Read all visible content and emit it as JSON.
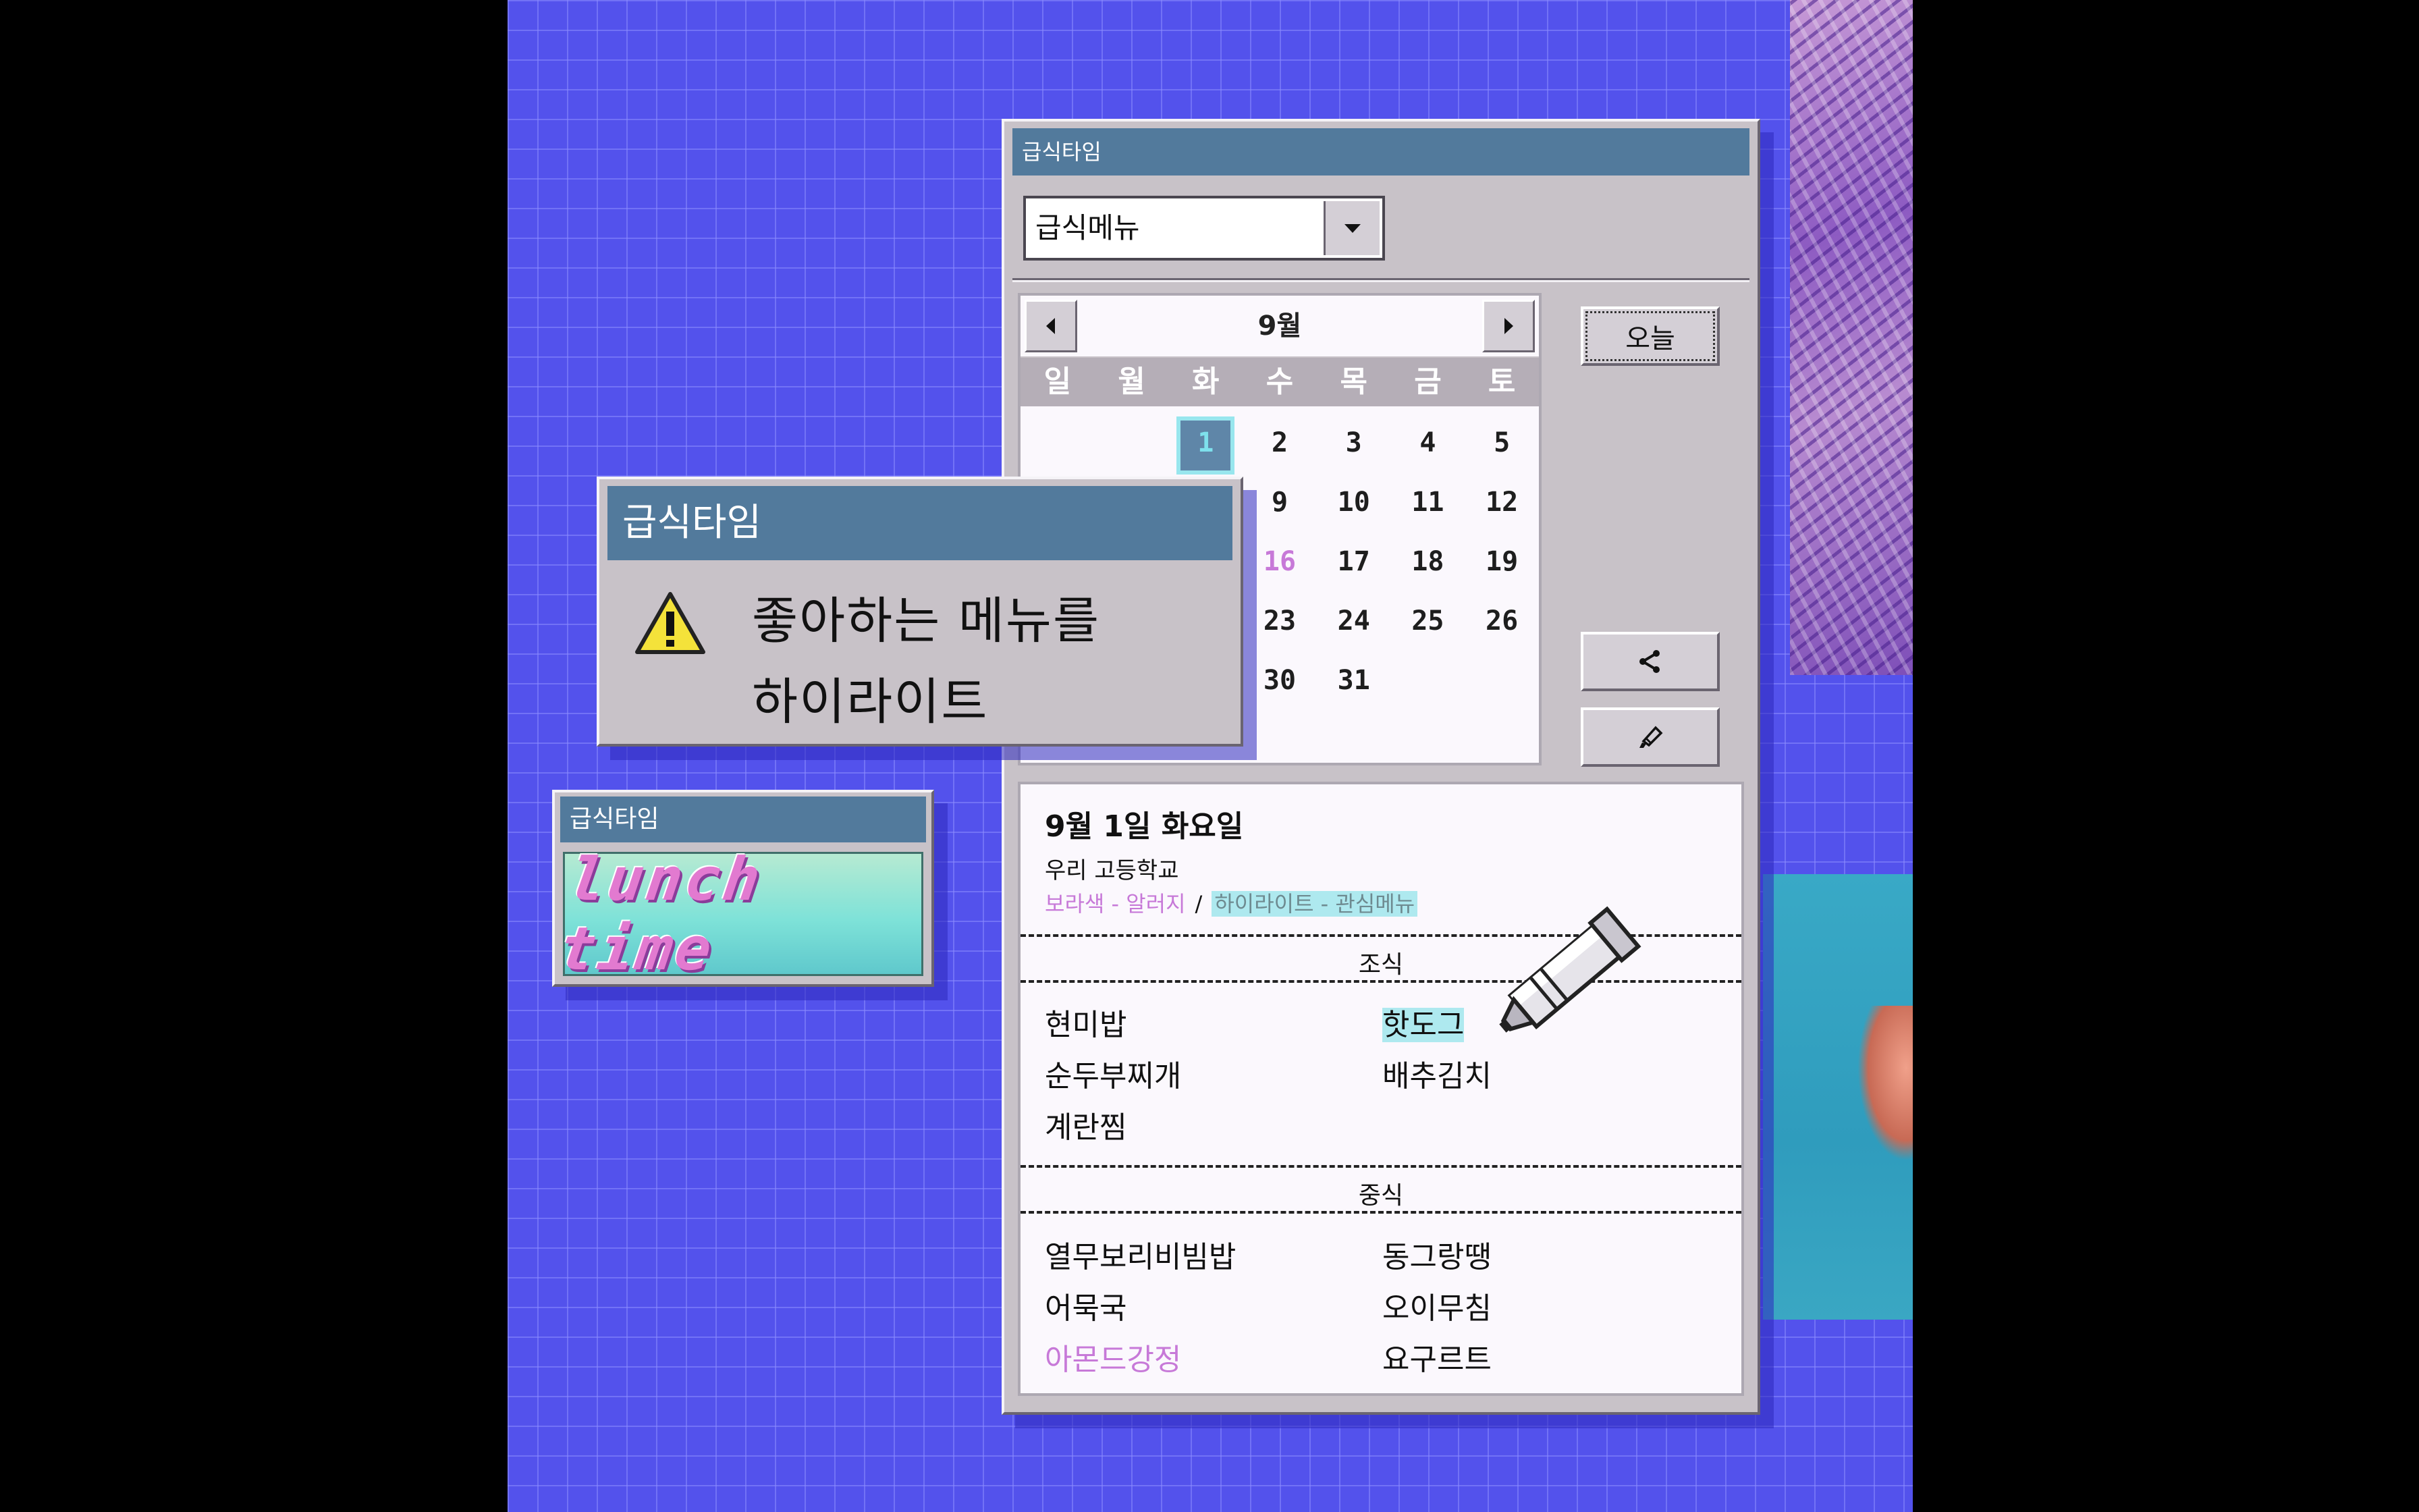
{
  "main_window": {
    "title": "급식타임",
    "menu_select": {
      "value": "급식메뉴"
    },
    "today_button": "오늘",
    "calendar": {
      "month": "9월",
      "weekdays": [
        "일",
        "월",
        "화",
        "수",
        "목",
        "금",
        "토"
      ],
      "days": [
        [
          "",
          "",
          "1",
          "2",
          "3",
          "4",
          "5"
        ],
        [
          "",
          "",
          "",
          "9",
          "10",
          "11",
          "12"
        ],
        [
          "",
          "",
          "",
          "16",
          "17",
          "18",
          "19"
        ],
        [
          "",
          "",
          "",
          "23",
          "24",
          "25",
          "26"
        ],
        [
          "",
          "",
          "",
          "30",
          "31",
          "",
          ""
        ]
      ],
      "selected_day": "1",
      "holiday_day": "16"
    },
    "info": {
      "date_title": "9월 1일 화요일",
      "school": "우리 고등학교",
      "legend_allergy": "보라색 - 알러지",
      "legend_slash": "/",
      "legend_highlight": "하이라이트 - 관심메뉴",
      "breakfast_label": "조식",
      "breakfast": [
        "현미밥",
        "핫도그",
        "순두부찌개",
        "배추김치",
        "계란찜"
      ],
      "lunch_label": "중식",
      "lunch": [
        "열무보리비빔밥",
        "동그랑땡",
        "어묵국",
        "오이무침",
        "아몬드강정",
        "요구르트"
      ]
    }
  },
  "alert_dialog": {
    "title": "급식타임",
    "message_line1": "좋아하는 메뉴를",
    "message_line2": "하이라이트"
  },
  "small_window": {
    "title": "급식타임",
    "banner_text": "lunch time"
  },
  "colors": {
    "background": "#5352ec",
    "titlebar": "#527a9c",
    "window": "#c8c2c8",
    "allergy": "#c779d8",
    "highlight": "#aee9ef"
  },
  "icons": [
    "chevron-down-icon",
    "arrow-left-icon",
    "arrow-right-icon",
    "share-icon",
    "highlighter-icon",
    "warning-icon"
  ]
}
